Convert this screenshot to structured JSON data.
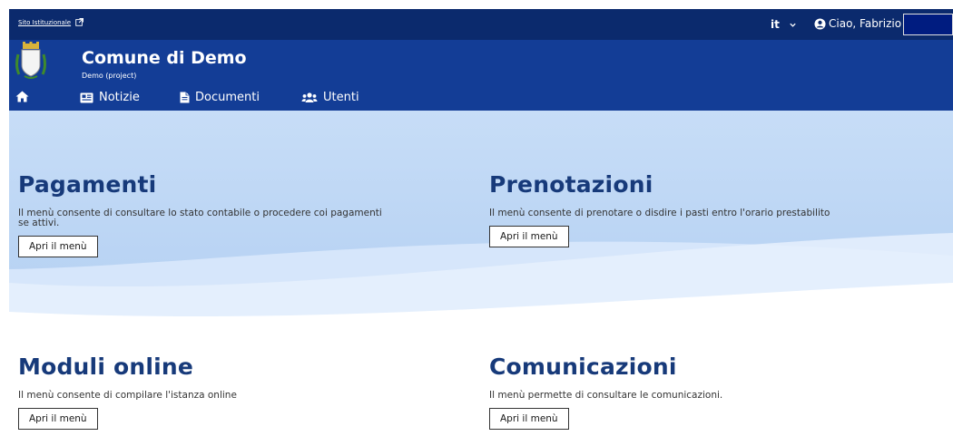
{
  "topbar": {
    "institutional_link": "Sito Istituzionale",
    "language": "it",
    "greeting": "Ciao, Fabrizio"
  },
  "header": {
    "title": "Comune di Demo",
    "subtitle": "Demo (project)"
  },
  "nav": {
    "items": [
      {
        "label": "Notizie",
        "icon": "newspaper-icon"
      },
      {
        "label": "Documenti",
        "icon": "document-icon"
      },
      {
        "label": "Utenti",
        "icon": "users-icon"
      }
    ]
  },
  "cards": [
    {
      "title": "Pagamenti",
      "description": "Il menù consente di consultare lo stato contabile o procedere coi pagamenti se attivi.",
      "button": "Apri il menù"
    },
    {
      "title": "Prenotazioni",
      "description": "Il menù consente di prenotare o disdire i pasti entro l'orario prestabilito",
      "button": "Apri il menù"
    },
    {
      "title": "Moduli online",
      "description": "Il menù consente di compilare l'istanza online",
      "button": "Apri il menù"
    },
    {
      "title": "Comunicazioni",
      "description": "Il menù permette di consultare le comunicazioni.",
      "button": "Apri il menù"
    }
  ],
  "colors": {
    "topbar": "#0b2a6d",
    "header": "#133d96",
    "title": "#173a7a",
    "hero_light": "#d7e7fb",
    "hero_mid": "#b9d5f4"
  }
}
